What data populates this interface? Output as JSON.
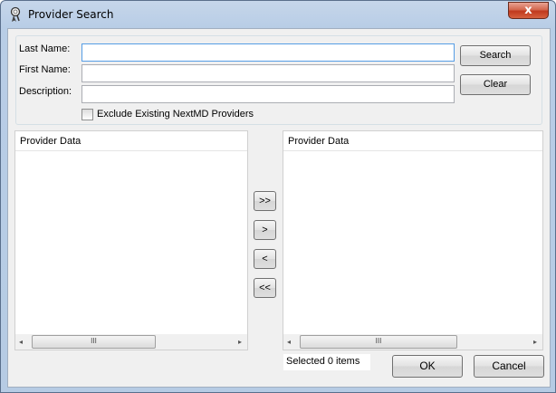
{
  "window": {
    "title": "Provider Search",
    "close_label": "x"
  },
  "icons": {
    "title": "provider-search-icon"
  },
  "search_form": {
    "last_name_label": "Last Name:",
    "first_name_label": "First Name:",
    "description_label": "Description:",
    "last_name_value": "",
    "first_name_value": "",
    "description_value": "",
    "search_label": "Search",
    "clear_label": "Clear",
    "exclude_label": "Exclude Existing NextMD Providers",
    "exclude_checked": false
  },
  "left_list": {
    "header": "Provider Data",
    "items": []
  },
  "right_list": {
    "header": "Provider Data",
    "items": []
  },
  "transfer_buttons": {
    "add_all": ">>",
    "add": ">",
    "remove": "<",
    "remove_all": "<<"
  },
  "scrollbar": {
    "thumb_grip": "III",
    "left_arrow": "◂",
    "right_arrow": "▸"
  },
  "status": {
    "selected_text": "Selected 0 items"
  },
  "footer": {
    "ok_label": "OK",
    "cancel_label": "Cancel"
  }
}
